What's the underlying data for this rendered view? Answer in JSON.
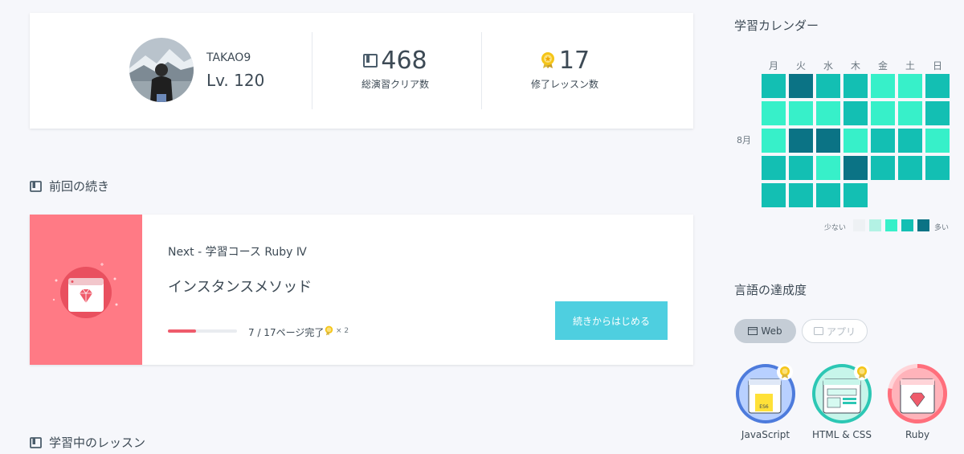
{
  "profile": {
    "username": "TAKAO9",
    "level": "Lv. 120",
    "stats": [
      {
        "icon": "book-icon",
        "value": "468",
        "label": "総演習クリア数"
      },
      {
        "icon": "medal-icon",
        "value": "17",
        "label": "修了レッスン数"
      }
    ]
  },
  "continue_section": {
    "heading": "前回の続き",
    "course": "Next - 学習コース Ruby Ⅳ",
    "lesson": "インスタンスメソッド",
    "progress_fraction": 0.41,
    "progress_text": "7 / 17ページ完了",
    "medal_count": "× 2",
    "button_label": "続きからはじめる"
  },
  "lessons_section": {
    "heading": "学習中のレッスン"
  },
  "calendar": {
    "title": "学習カレンダー",
    "weekdays": [
      "月",
      "火",
      "水",
      "木",
      "金",
      "土",
      "日"
    ],
    "month_label": "8月",
    "rows": [
      [
        3,
        4,
        3,
        3,
        2,
        2,
        3
      ],
      [
        2,
        2,
        2,
        3,
        2,
        2,
        3
      ],
      [
        2,
        5,
        4,
        2,
        3,
        3,
        2
      ],
      [
        3,
        3,
        2,
        4,
        3,
        3,
        3
      ],
      [
        3,
        3,
        3,
        3
      ]
    ],
    "level_colors": [
      "#eef1f4",
      "#b3f2e4",
      "#37f0c9",
      "#13bfb3",
      "#0b7385",
      "#0b7385"
    ],
    "legend": {
      "less": "少ない",
      "more": "多い",
      "levels": [
        0,
        1,
        2,
        3,
        4
      ]
    }
  },
  "achievement": {
    "title": "言語の達成度",
    "tabs": [
      {
        "label": "Web",
        "active": true
      },
      {
        "label": "アプリ",
        "active": false
      }
    ],
    "languages": [
      {
        "name": "JavaScript",
        "color": "#4d7bdc",
        "medal": true,
        "icon": "javascript-icon",
        "progress": 1.0
      },
      {
        "name": "HTML & CSS",
        "color": "#2cc7b4",
        "medal": true,
        "icon": "html-css-icon",
        "progress": 1.0
      },
      {
        "name": "Ruby",
        "color": "#ff6f7c",
        "medal": false,
        "icon": "ruby-icon",
        "progress": 0.78
      }
    ]
  }
}
